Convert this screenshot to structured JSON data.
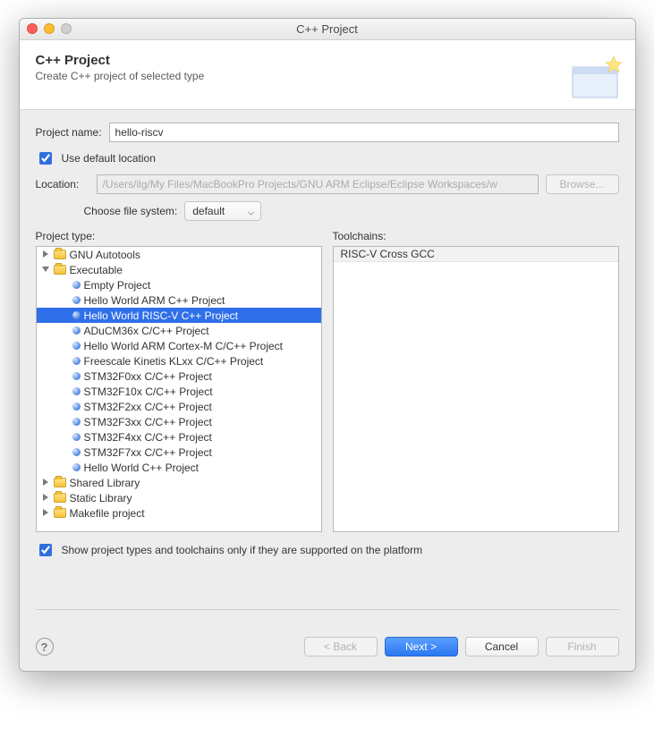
{
  "window": {
    "title": "C++ Project"
  },
  "header": {
    "title": "C++ Project",
    "subtitle": "Create C++ project of selected type"
  },
  "form": {
    "project_name_label": "Project name:",
    "project_name_value": "hello-riscv",
    "use_default_location_label": "Use default location",
    "use_default_location_checked": true,
    "location_label": "Location:",
    "location_value": "/Users/ilg/My Files/MacBookPro Projects/GNU ARM Eclipse/Eclipse Workspaces/w",
    "location_enabled": false,
    "browse_label": "Browse...",
    "choose_fs_label": "Choose file system:",
    "choose_fs_value": "default"
  },
  "lists": {
    "project_type_label": "Project type:",
    "toolchains_label": "Toolchains:",
    "toolchains": [
      "RISC-V Cross GCC"
    ],
    "tree": [
      {
        "level": 0,
        "icon": "folder",
        "disclosure": "right",
        "label": "GNU Autotools"
      },
      {
        "level": 0,
        "icon": "folder",
        "disclosure": "down",
        "label": "Executable"
      },
      {
        "level": 1,
        "icon": "dot",
        "label": "Empty Project"
      },
      {
        "level": 1,
        "icon": "dot",
        "label": "Hello World ARM C++ Project"
      },
      {
        "level": 1,
        "icon": "dot",
        "label": "Hello World RISC-V C++ Project",
        "selected": true
      },
      {
        "level": 1,
        "icon": "dot",
        "label": "ADuCM36x C/C++ Project"
      },
      {
        "level": 1,
        "icon": "dot",
        "label": "Hello World ARM Cortex-M C/C++ Project"
      },
      {
        "level": 1,
        "icon": "dot",
        "label": "Freescale Kinetis KLxx C/C++ Project"
      },
      {
        "level": 1,
        "icon": "dot",
        "label": "STM32F0xx C/C++ Project"
      },
      {
        "level": 1,
        "icon": "dot",
        "label": "STM32F10x C/C++ Project"
      },
      {
        "level": 1,
        "icon": "dot",
        "label": "STM32F2xx C/C++ Project"
      },
      {
        "level": 1,
        "icon": "dot",
        "label": "STM32F3xx C/C++ Project"
      },
      {
        "level": 1,
        "icon": "dot",
        "label": "STM32F4xx C/C++ Project"
      },
      {
        "level": 1,
        "icon": "dot",
        "label": "STM32F7xx C/C++ Project"
      },
      {
        "level": 1,
        "icon": "dot",
        "label": "Hello World C++ Project"
      },
      {
        "level": 0,
        "icon": "folder",
        "disclosure": "right",
        "label": "Shared Library"
      },
      {
        "level": 0,
        "icon": "folder",
        "disclosure": "right",
        "label": "Static Library"
      },
      {
        "level": 0,
        "icon": "folder",
        "disclosure": "right",
        "label": "Makefile project"
      }
    ]
  },
  "filter": {
    "label": "Show project types and toolchains only if they are supported on the platform",
    "checked": true
  },
  "buttons": {
    "back": "< Back",
    "next": "Next >",
    "cancel": "Cancel",
    "finish": "Finish"
  }
}
